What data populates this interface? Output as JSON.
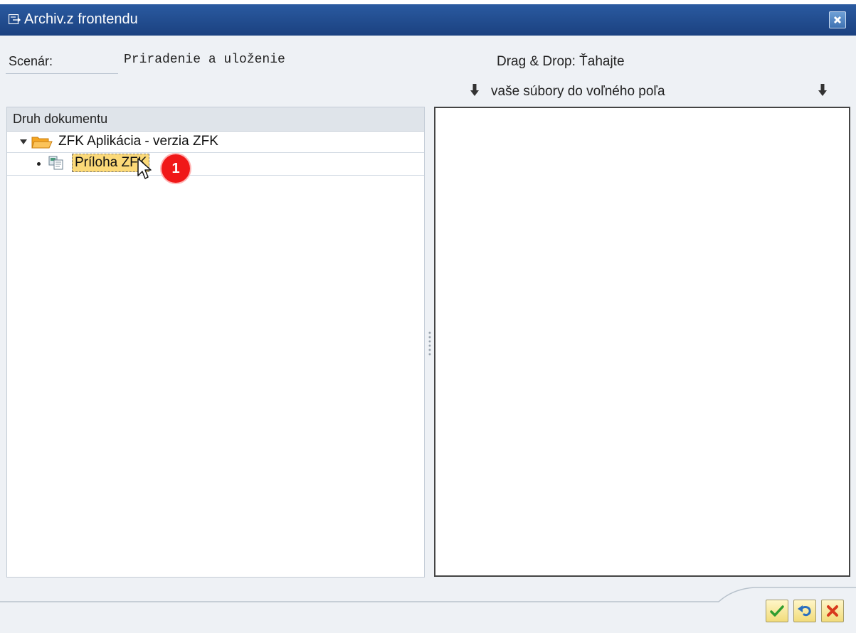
{
  "dialog": {
    "title": "Archiv.z frontendu",
    "colors": {
      "titlebar": "#1f4a8a",
      "selection": "#fbd978",
      "badge": "#f01818"
    }
  },
  "scenario": {
    "label": "Scenár:",
    "value": "Priradenie a uloženie"
  },
  "dragdrop": {
    "line1": "Drag & Drop: Ťahajte",
    "line2": "vaše súbory do voľného poľa"
  },
  "tree": {
    "header": "Druh dokumentu",
    "nodes": [
      {
        "label": "ZFK Aplikácia - verzia ZFK",
        "icon": "open-folder-icon",
        "expanded": true
      },
      {
        "label": "Príloha ZFK",
        "icon": "document-type-icon",
        "selected": true
      }
    ]
  },
  "annotation": {
    "step": "1"
  },
  "footer": {
    "buttons": [
      {
        "name": "confirm",
        "icon": "check-icon"
      },
      {
        "name": "undo",
        "icon": "undo-icon"
      },
      {
        "name": "cancel",
        "icon": "cancel-x-icon"
      }
    ]
  }
}
